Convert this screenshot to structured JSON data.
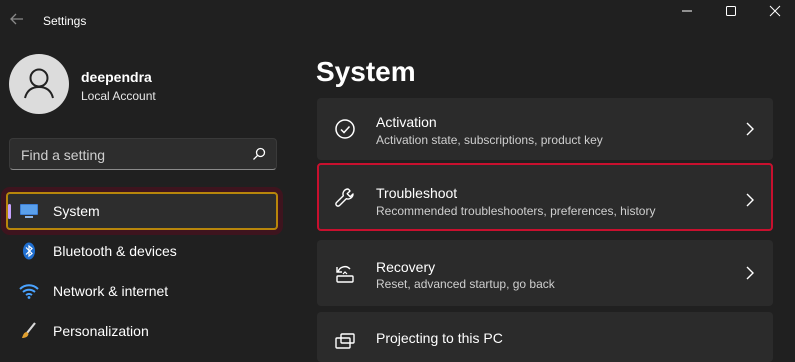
{
  "window": {
    "title": "Settings",
    "minimize": "—",
    "maximize": "☐",
    "close": "✕"
  },
  "account": {
    "name": "deependra",
    "type": "Local Account"
  },
  "search": {
    "placeholder": "Find a setting"
  },
  "nav": [
    {
      "label": "System",
      "icon": "monitor-icon",
      "active": true
    },
    {
      "label": "Bluetooth & devices",
      "icon": "bluetooth-icon"
    },
    {
      "label": "Network & internet",
      "icon": "wifi-icon"
    },
    {
      "label": "Personalization",
      "icon": "brush-icon"
    }
  ],
  "main": {
    "title": "System",
    "cards": [
      {
        "title": "Activation",
        "subtitle": "Activation state, subscriptions, product key",
        "icon": "check-circle-icon"
      },
      {
        "title": "Troubleshoot",
        "subtitle": "Recommended troubleshooters, preferences, history",
        "icon": "wrench-icon",
        "highlighted": true
      },
      {
        "title": "Recovery",
        "subtitle": "Reset, advanced startup, go back",
        "icon": "recovery-icon"
      },
      {
        "title": "Projecting to this PC",
        "subtitle": "",
        "icon": "projector-icon"
      }
    ]
  },
  "colors": {
    "accent": "#c8a2ff",
    "highlight": "#c8102e",
    "nav_highlight": "#b8860b"
  }
}
